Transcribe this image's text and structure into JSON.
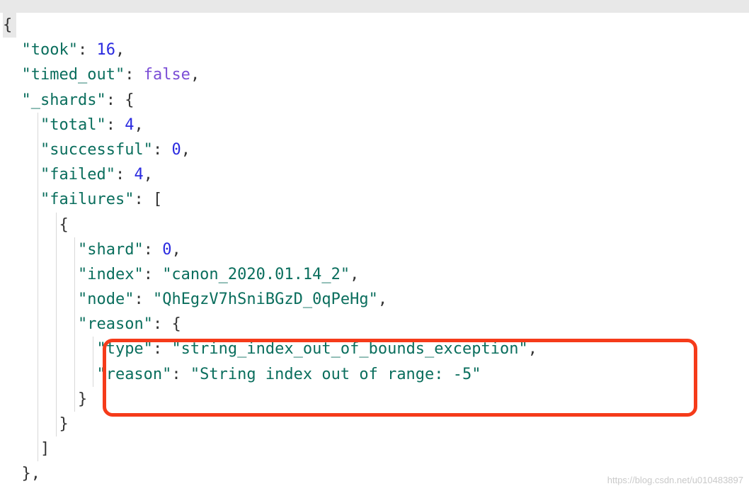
{
  "code": {
    "open_brace": "{",
    "took_key": "\"took\"",
    "colon": ": ",
    "took_val": "16",
    "comma": ",",
    "timed_out_key": "\"timed_out\"",
    "timed_out_val": "false",
    "shards_key": "\"_shards\"",
    "open_brace2": "{",
    "total_key": "\"total\"",
    "total_val": "4",
    "successful_key": "\"successful\"",
    "successful_val": "0",
    "failed_key": "\"failed\"",
    "failed_val": "4",
    "failures_key": "\"failures\"",
    "open_bracket": "[",
    "open_brace3": "{",
    "shard_key": "\"shard\"",
    "shard_val": "0",
    "index_key": "\"index\"",
    "index_val": "\"canon_2020.01.14_2\"",
    "node_key": "\"node\"",
    "node_val": "\"QhEgzV7hSniBGzD_0qPeHg\"",
    "reason_key": "\"reason\"",
    "open_brace4": "{",
    "type_key": "\"type\"",
    "type_val": "\"string_index_out_of_bounds_exception\"",
    "inner_reason_key": "\"reason\"",
    "inner_reason_val": "\"String index out of range: -5\"",
    "close_brace4": "}",
    "close_brace3": "}",
    "close_bracket": "]",
    "close_brace2": "},"
  },
  "watermark": "https://blog.csdn.net/u010483897"
}
